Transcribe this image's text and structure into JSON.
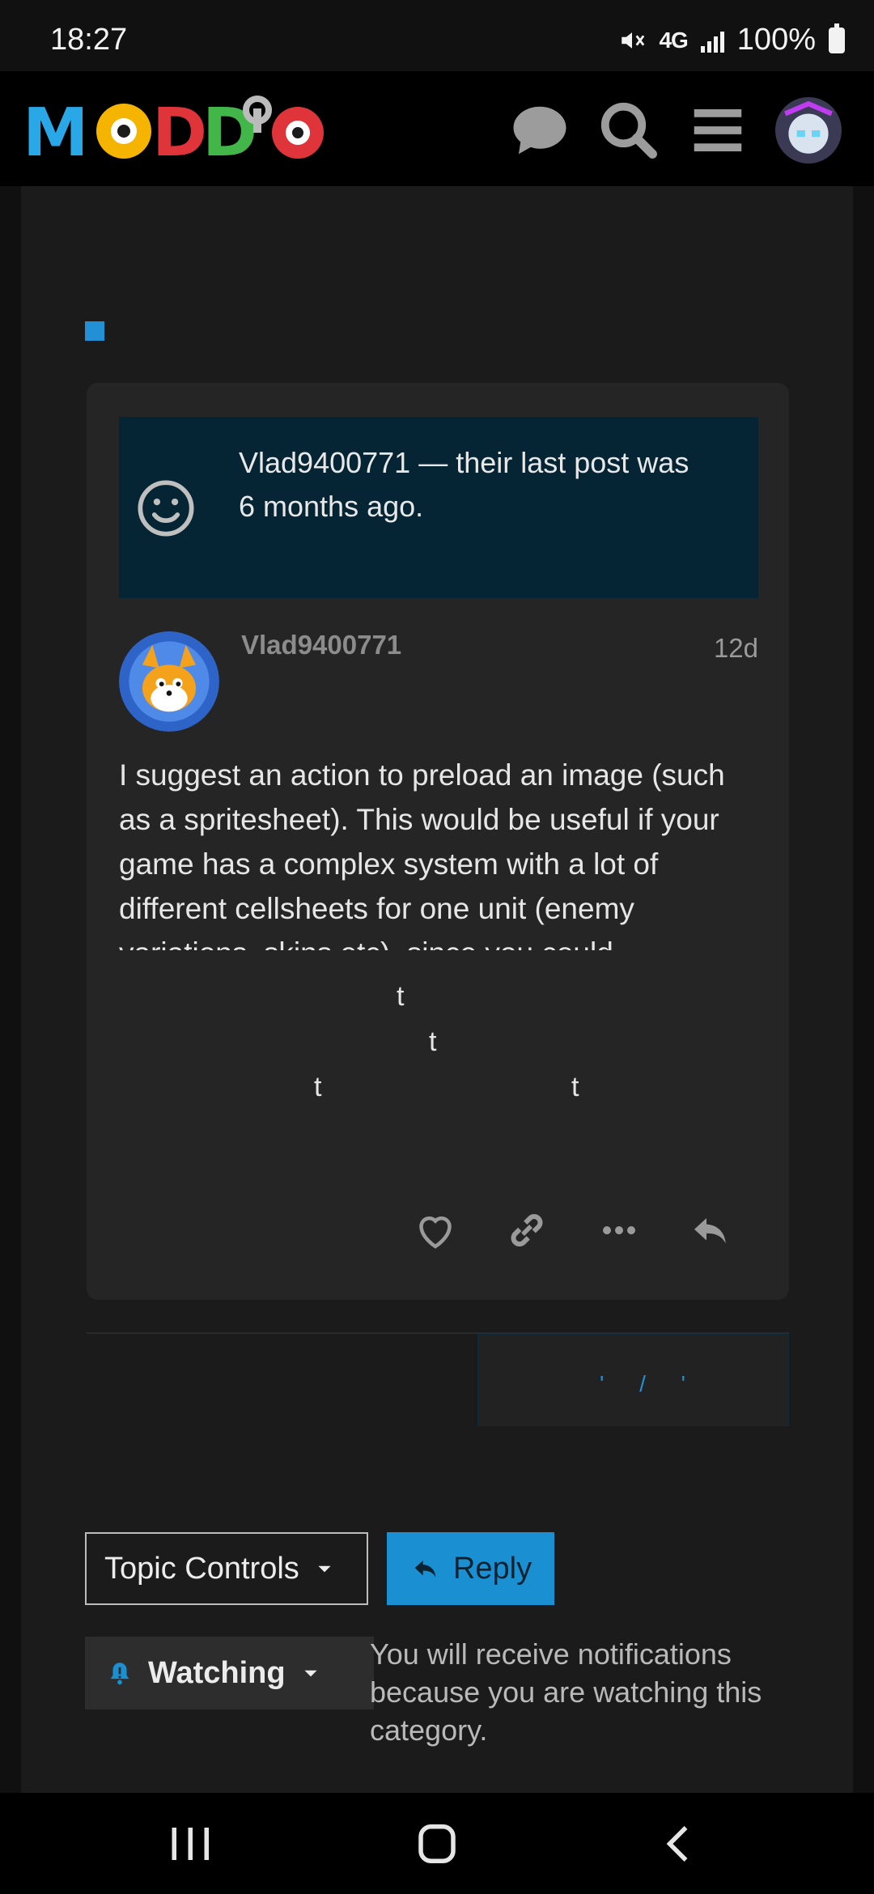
{
  "status_bar": {
    "time": "18:27",
    "network": "4G",
    "battery": "100%",
    "icons": [
      "mute-icon",
      "signal-icon",
      "battery-icon"
    ]
  },
  "header": {
    "logo_text": "MODD.IO",
    "icons": [
      "chat-icon",
      "search-icon",
      "menu-icon",
      "user-avatar"
    ]
  },
  "notice": {
    "icon": "smiley-face-icon",
    "partial_line": "Vlad9400771 — their last post was",
    "visible_line": "6 months ago."
  },
  "post": {
    "username": "Vlad9400771",
    "date": "12d",
    "body": "I suggest an action to preload an image (such as a spritesheet). This would be useful if your game has a complex system with a lot of different cellsheets for one unit (enemy variations, skins etc), since you could",
    "fragments": [
      "t",
      "t",
      "t",
      "t"
    ],
    "actions": [
      "like-heart-icon",
      "copy-link-icon",
      "more-dots-icon",
      "reply-arrow-icon"
    ]
  },
  "suggest_box_text": "' / '",
  "controls": {
    "topic_controls_label": "Topic Controls",
    "reply_label": "Reply",
    "watching_label": "Watching",
    "watching_note": "You will receive notifications because you are watching this category."
  },
  "colors": {
    "accent": "#1a8fd2",
    "notice_bg": "#052434",
    "card_bg": "#252525",
    "page_bg": "#1b1b1b"
  }
}
